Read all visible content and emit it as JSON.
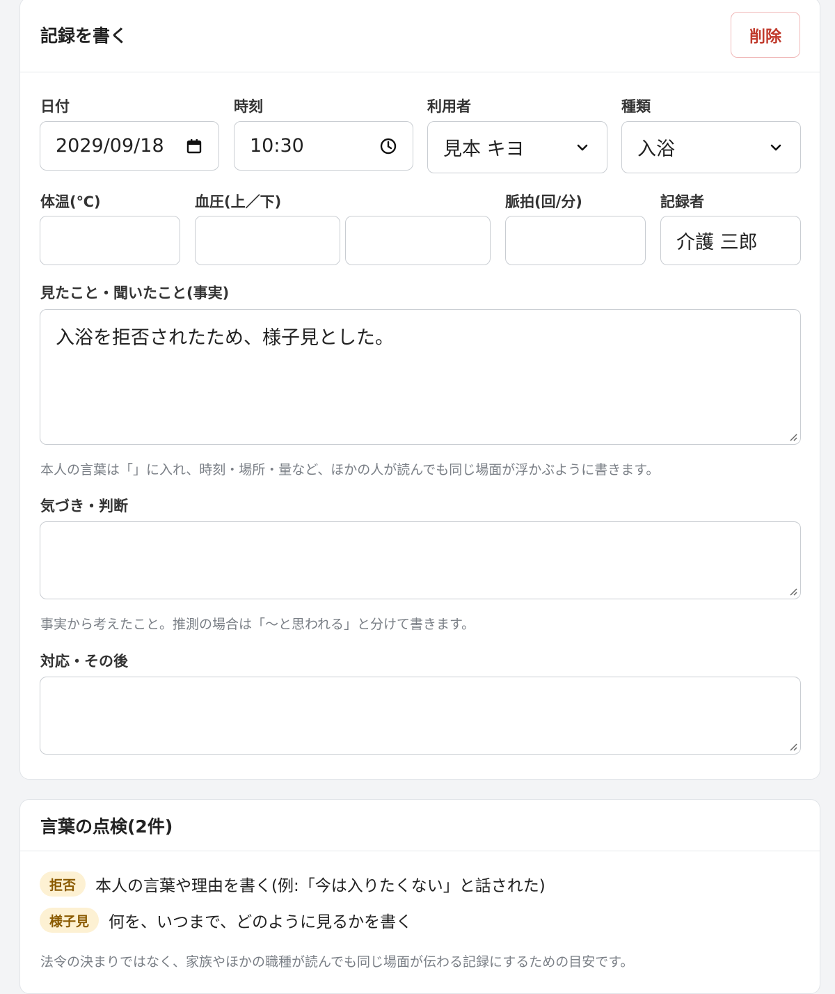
{
  "edit": {
    "title": "記録を書く",
    "delete_label": "削除",
    "labels": {
      "date": "日付",
      "time": "時刻",
      "resident": "利用者",
      "kind": "種類",
      "temp": "体温(℃)",
      "bp": "血圧(上／下)",
      "pulse": "脈拍(回/分)",
      "recorder": "記録者",
      "facts": "見たこと・聞いたこと(事実)",
      "notice": "気づき・判断",
      "response": "対応・その後"
    },
    "values": {
      "date": "2029/09/18",
      "time": "10:30",
      "resident": "見本 キヨ",
      "kind": "入浴",
      "temp": "",
      "bp_upper": "",
      "bp_lower": "",
      "pulse": "",
      "recorder": "介護 三郎",
      "facts": "入浴を拒否されたため、様子見とした。",
      "notice": "",
      "response": ""
    },
    "hints": {
      "facts": "本人の言葉は「」に入れ、時刻・場所・量など、ほかの人が読んでも同じ場面が浮かぶように書きます。",
      "notice": "事実から考えたこと。推測の場合は「〜と思われる」と分けて書きます。"
    }
  },
  "check": {
    "title": "言葉の点検(2件)",
    "items": [
      {
        "tag": "拒否",
        "text": "本人の言葉や理由を書く(例:「今は入りたくない」と話された)"
      },
      {
        "tag": "様子見",
        "text": "何を、いつまで、どのように見るかを書く"
      }
    ],
    "note": "法令の決まりではなく、家族やほかの職種が読んでも同じ場面が伝わる記録にするための目安です。"
  },
  "icons": {
    "date": "calendar-icon",
    "time": "clock-icon",
    "select": "chevron-down-icon",
    "resize": "resize-grip-icon"
  }
}
